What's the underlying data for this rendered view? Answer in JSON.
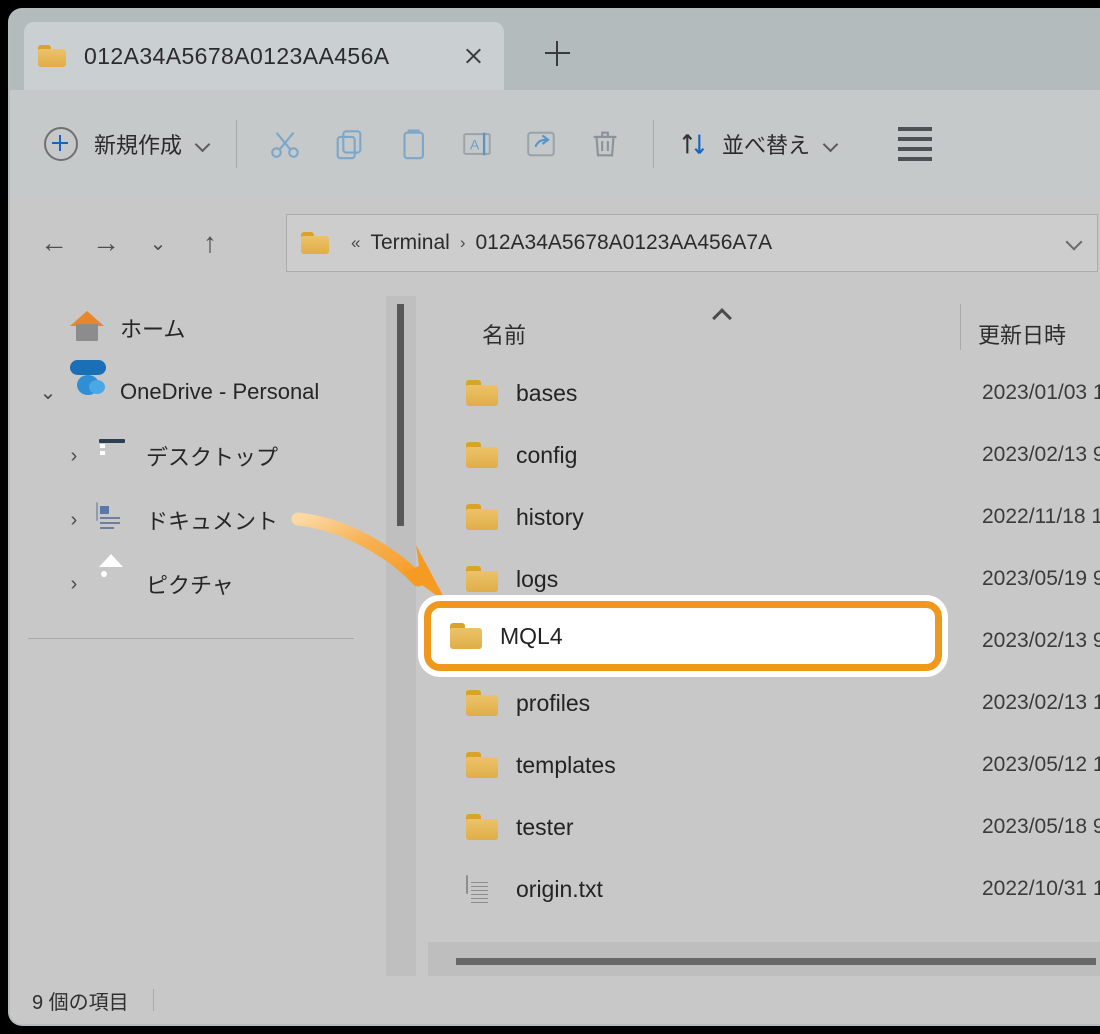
{
  "window": {
    "tab": {
      "title": "012A34A5678A0123AA456A",
      "folder_icon": "folder-icon",
      "close_icon": "close-icon"
    },
    "new_tab_icon": "plus-icon"
  },
  "toolbar": {
    "new_label": "新規作成",
    "new_icon": "circle-plus-icon",
    "new_chevron": "chevron-down-icon",
    "icons": [
      {
        "name": "cut-icon",
        "label": "切り取り"
      },
      {
        "name": "copy-icon",
        "label": "コピー"
      },
      {
        "name": "paste-icon",
        "label": "貼り付け"
      },
      {
        "name": "rename-icon",
        "label": "名前の変更"
      },
      {
        "name": "share-icon",
        "label": "共有"
      },
      {
        "name": "delete-icon",
        "label": "削除"
      }
    ],
    "sort_label": "並べ替え",
    "sort_icon": "sort-arrows-icon",
    "sort_chevron": "chevron-down-icon",
    "view_icon": "list-view-icon"
  },
  "navbar": {
    "back_icon": "arrow-left-icon",
    "forward_icon": "arrow-right-icon",
    "recent_icon": "chevron-down-icon",
    "up_icon": "arrow-up-icon",
    "address": {
      "folder_icon": "folder-icon",
      "overflow": "«",
      "segments": [
        "Terminal",
        "012A34A5678A0123AA456A7A"
      ],
      "separator": "›",
      "dropdown_icon": "chevron-down-icon"
    }
  },
  "sidebar": {
    "items": [
      {
        "label": "ホーム",
        "icon": "home-icon",
        "expander": "",
        "indent": 0
      },
      {
        "label": "OneDrive - Personal",
        "icon": "cloud-icon",
        "expander": "⌄",
        "indent": 0
      },
      {
        "label": "デスクトップ",
        "icon": "desktop-icon",
        "expander": "›",
        "indent": 1
      },
      {
        "label": "ドキュメント",
        "icon": "documents-icon",
        "expander": "›",
        "indent": 1
      },
      {
        "label": "ピクチャ",
        "icon": "pictures-icon",
        "expander": "›",
        "indent": 1
      }
    ]
  },
  "filelist": {
    "columns": {
      "name": "名前",
      "date": "更新日時"
    },
    "sort_indicator": "chevron-up-icon",
    "rows": [
      {
        "name": "bases",
        "icon": "folder-icon",
        "date": "2023/01/03 1"
      },
      {
        "name": "config",
        "icon": "folder-icon",
        "date": "2023/02/13 9"
      },
      {
        "name": "history",
        "icon": "folder-icon",
        "date": "2022/11/18 1"
      },
      {
        "name": "logs",
        "icon": "folder-icon",
        "date": "2023/05/19 9"
      },
      {
        "name": "MQL4",
        "icon": "folder-icon",
        "date": "2023/02/13 9"
      },
      {
        "name": "profiles",
        "icon": "folder-icon",
        "date": "2023/02/13 1"
      },
      {
        "name": "templates",
        "icon": "folder-icon",
        "date": "2023/05/12 1"
      },
      {
        "name": "tester",
        "icon": "folder-icon",
        "date": "2023/05/18 9"
      },
      {
        "name": "origin.txt",
        "icon": "text-file-icon",
        "date": "2022/10/31 1"
      }
    ]
  },
  "statusbar": {
    "item_count": "9 個の項目"
  },
  "annotation": {
    "highlight_target": "MQL4",
    "highlight_color": "#f0981e",
    "arrow_color": "#f5a33c",
    "arrow_icon": "curved-arrow-icon"
  }
}
